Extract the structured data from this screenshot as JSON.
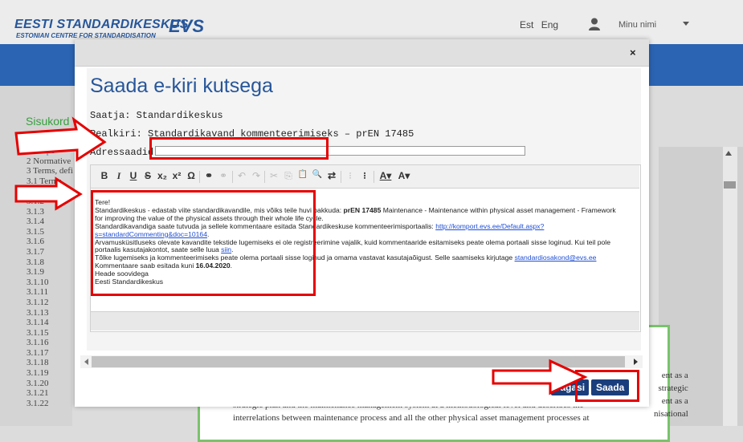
{
  "header": {
    "logo_line1": "EESTI STANDARDIKESKUS",
    "logo_line2": "ESTONIAN CENTRE FOR STANDARDISATION",
    "logo_mark": "EVS",
    "lang_est": "Est",
    "lang_eng": "Eng",
    "user_name": "Minu nimi"
  },
  "sidebar": {
    "title": "Sisukord",
    "toc": [
      "1 Scope",
      "2 Normative",
      "3 Terms, defi",
      "3.1 Terms",
      "3.1.1",
      "3.1.2",
      "3.1.3",
      "3.1.4",
      "3.1.5",
      "3.1.6",
      "3.1.7",
      "3.1.8",
      "3.1.9",
      "3.1.10",
      "3.1.11",
      "3.1.12",
      "3.1.13",
      "3.1.14",
      "3.1.15",
      "3.1.16",
      "3.1.17",
      "3.1.18",
      "3.1.19",
      "3.1.20",
      "3.1.21",
      "3.1.22"
    ]
  },
  "document": {
    "right_lines": [
      "ent as a",
      "strategic",
      "ent as a",
      "nisational"
    ],
    "bottom_lines": [
      "strategic plan and the maintenance management system at a methodological level and describes the",
      "interrelations between maintenance process and all the other physical asset management processes at"
    ]
  },
  "modal": {
    "close": "×",
    "title": "Saada e-kiri kutsega",
    "sender": "Saatja: Standardikeskus",
    "subject": "Pealkiri: Standardikavand kommenteerimiseks – prEN 17485",
    "recipients_label": "Adressaadid:",
    "recipients_value": "",
    "toolbar": [
      "B",
      "I",
      "U",
      "S",
      "x₂",
      "x²",
      "Ω",
      "⚭",
      "⚭",
      "↶",
      "↷",
      "✂",
      "⎘",
      "📋",
      "🔍",
      "⇄",
      "⁝",
      "⁝",
      "A▾",
      "A▾"
    ],
    "body": {
      "greeting": "Tere!",
      "l1_a": "Standardikeskus - edastab viite standardikavandile, mis võiks teile huvi pakkuda: ",
      "l1_b": "prEN 17485",
      "l1_c": " Maintenance - Maintenance within physical asset management - Framework for improving the value of the physical assets through their whole life cycle.",
      "l2_a": "Standardikavandiga saate tutvuda ja sellele kommentaare esitada Standardikeskuse kommenteerimisportaalis: ",
      "l2_link": "http://komport.evs.ee/Default.aspx?s=standardCommenting&doc=10164",
      "l2_c": ".",
      "l3": "Arvamusküsitluseks olevate kavandite tekstide lugemiseks ei ole registreerimine vajalik, kuid kommentaaride esitamiseks peate olema portaali sisse loginud. Kui teil pole portaalis kasutajakontot, saate selle luua ",
      "l3_link": "siin",
      "l3_end": ".",
      "l4_a": "Tõlke lugemiseks ja kommenteerimiseks peate olema portaali sisse loginud ja omama vastavat kasutajaõigust. Selle saamiseks kirjutage ",
      "l4_link": "standardiosakond@evs.ee",
      "l5_a": "Kommentaare saab esitada kuni ",
      "l5_b": "16.04.2020",
      "l5_c": ".",
      "l6": "Heade soovidega",
      "l7": "Eesti Standardikeskus"
    },
    "back_label": "Tagasi",
    "send_label": "Saada"
  },
  "colors": {
    "brand_blue": "#27569a",
    "header_blue": "#2b64b3",
    "button_blue": "#1a3e7c",
    "annotation_red": "#e60000",
    "sidebar_green": "#37a13e"
  }
}
